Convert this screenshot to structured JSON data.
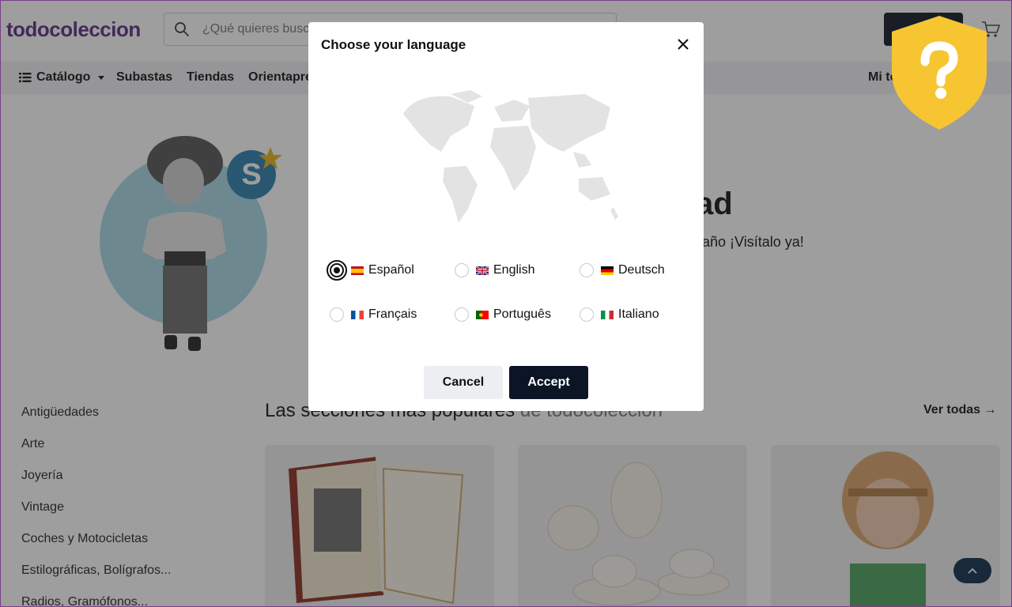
{
  "header": {
    "logo": "todocoleccion",
    "search_placeholder": "¿Qué quieres buscar?",
    "icons": {
      "search": "search-icon",
      "cart": "cart-icon"
    }
  },
  "nav": {
    "catalog": "Catálogo",
    "auctions": "Subastas",
    "stores": "Tiendas",
    "guidance": "Orientaprecios",
    "account": "Mi todocoleccion"
  },
  "hero": {
    "title_fragment": "ad",
    "subtitle_fragment": "año ¡Visítalo ya!",
    "badge_letter": "S"
  },
  "sidebar": {
    "items": [
      "Antigüedades",
      "Arte",
      "Joyería",
      "Vintage",
      "Coches y Motocicletas",
      "Estilográficas, Bolígrafos...",
      "Radios, Gramófonos..."
    ]
  },
  "popular": {
    "title": "Las secciones más populares",
    "title_muted": "de todocoleccion",
    "see_all": "Ver todas"
  },
  "modal": {
    "title": "Choose your language",
    "languages": [
      {
        "label": "Español",
        "flag": "es",
        "selected": true
      },
      {
        "label": "English",
        "flag": "gb",
        "selected": false
      },
      {
        "label": "Deutsch",
        "flag": "de",
        "selected": false
      },
      {
        "label": "Français",
        "flag": "fr",
        "selected": false
      },
      {
        "label": "Português",
        "flag": "pt",
        "selected": false
      },
      {
        "label": "Italiano",
        "flag": "it",
        "selected": false
      }
    ],
    "cancel": "Cancel",
    "accept": "Accept"
  },
  "colors": {
    "brand": "#5b2a86",
    "dark_button": "#0b1526",
    "shield": "#f7c531"
  }
}
